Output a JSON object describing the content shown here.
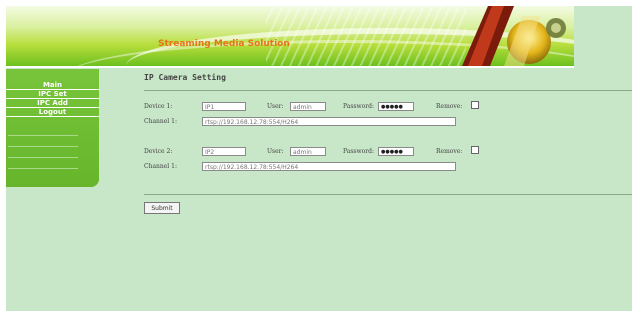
{
  "banner": {
    "title": "Streaming Media Solution"
  },
  "sidebar": {
    "items": [
      {
        "label": "Main"
      },
      {
        "label": "IPC Set"
      },
      {
        "label": "IPC Add"
      },
      {
        "label": "Logout"
      }
    ]
  },
  "page": {
    "title": "IP Camera Setting"
  },
  "devices": [
    {
      "device_label": "Device 1:",
      "device_value": "IP1",
      "user_label": "User:",
      "user_value": "admin",
      "password_label": "Password:",
      "password_value": "●●●●●",
      "remove_label": "Remove:",
      "channel_label": "Channel 1:",
      "channel_value": "rtsp://192.168.12.78:554/H264"
    },
    {
      "device_label": "Device 2:",
      "device_value": "IP2",
      "user_label": "User:",
      "user_value": "admin",
      "password_label": "Password:",
      "password_value": "●●●●●",
      "remove_label": "Remove:",
      "channel_label": "Channel 1:",
      "channel_value": "rtsp://192.168.12.78:554/H264"
    }
  ],
  "form": {
    "submit_label": "Submit"
  },
  "colors": {
    "background": "#c8e6c8",
    "sidebar": "#6cbc2e",
    "banner_title": "#e8731a"
  }
}
